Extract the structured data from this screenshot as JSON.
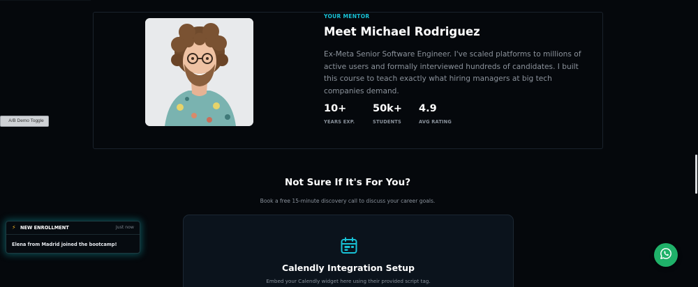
{
  "mentor": {
    "eyebrow": "YOUR MENTOR",
    "name": "Meet Michael Rodriguez",
    "bio": "Ex-Meta Senior Software Engineer. I've scaled platforms to millions of active users and formally interviewed hundreds of candidates. I built this course to teach exactly what hiring managers at big tech companies demand.",
    "stats": [
      {
        "value": "10+",
        "label": "YEARS EXP."
      },
      {
        "value": "50k+",
        "label": "STUDENTS"
      },
      {
        "value": "4.9",
        "label": "AVG RATING"
      }
    ]
  },
  "ab_toggle": {
    "label": "A/B Demo Toggle"
  },
  "discovery": {
    "title": "Not Sure If It's For You?",
    "subtitle": "Book a free 15-minute discovery call to discuss your career goals.",
    "calendly": {
      "icon": "calendar-icon",
      "title": "Calendly Integration Setup",
      "subtitle": "Embed your Calendly widget here using their provided script tag."
    }
  },
  "toast": {
    "icon": "lightning-icon",
    "title": "NEW ENROLLMENT",
    "time": "Just now",
    "message": "Elena from Madrid joined the bootcamp!"
  },
  "whatsapp": {
    "icon": "whatsapp-icon"
  },
  "colors": {
    "accent": "#18c2d6",
    "background": "#05080c",
    "card": "#0b131c",
    "whatsapp": "#1fb169",
    "bolt": "#f5b623"
  }
}
